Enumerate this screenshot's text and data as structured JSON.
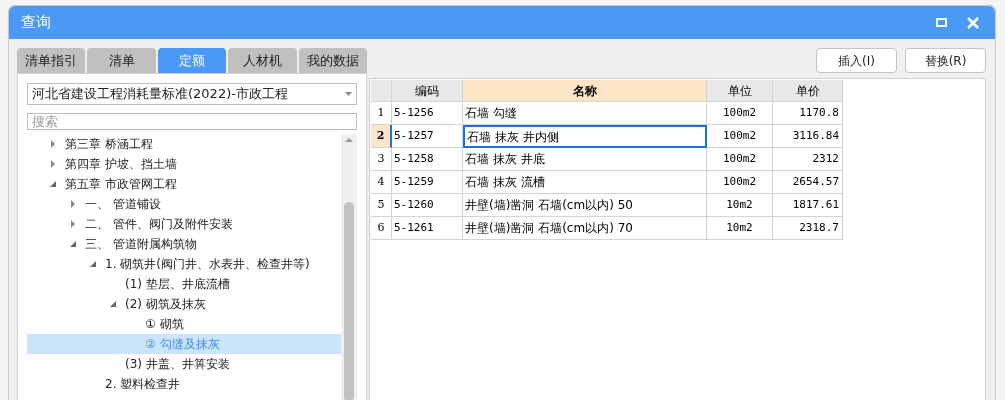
{
  "window": {
    "title": "查询"
  },
  "tabs": [
    {
      "label": "清单指引",
      "selected": false
    },
    {
      "label": "清单",
      "selected": false
    },
    {
      "label": "定额",
      "selected": true
    },
    {
      "label": "人材机",
      "selected": false
    },
    {
      "label": "我的数据",
      "selected": false
    }
  ],
  "library_select": {
    "value": "河北省建设工程消耗量标准(2022)-市政工程"
  },
  "search": {
    "placeholder": "搜索"
  },
  "tree": [
    {
      "label": "第三章 桥涵工程",
      "expanded": false,
      "selected": false
    },
    {
      "label": "第四章 护坡、挡土墙",
      "expanded": false,
      "selected": false
    },
    {
      "label": "第五章 市政管网工程",
      "expanded": true,
      "selected": false,
      "children": [
        {
          "label": "一、 管道铺设",
          "expanded": false,
          "selected": false
        },
        {
          "label": "二、 管件、阀门及附件安装",
          "expanded": false,
          "selected": false
        },
        {
          "label": "三、 管道附属构筑物",
          "expanded": true,
          "selected": false,
          "children": [
            {
              "label": "1. 砌筑井(阀门井、水表井、检查井等)",
              "expanded": true,
              "selected": false,
              "children": [
                {
                  "label": "(1) 垫层、井底流槽",
                  "selected": false
                },
                {
                  "label": "(2) 砌筑及抹灰",
                  "expanded": true,
                  "selected": false,
                  "children": [
                    {
                      "label": "① 砌筑",
                      "selected": false
                    },
                    {
                      "label": "② 勾缝及抹灰",
                      "selected": true
                    }
                  ]
                },
                {
                  "label": "(3) 井盖、井箅安装",
                  "selected": false
                }
              ]
            },
            {
              "label": "2. 塑料检查井",
              "selected": false
            }
          ]
        }
      ]
    }
  ],
  "buttons": [
    "插入(I)",
    "替换(R)"
  ],
  "table": {
    "columns": [
      {
        "label": "编码",
        "selected": false
      },
      {
        "label": "名称",
        "selected": true
      },
      {
        "label": "单位",
        "selected": false
      },
      {
        "label": "单价",
        "selected": false
      }
    ],
    "rows": [
      {
        "number": "1",
        "code": "5-1256",
        "name": "石墙 勾缝",
        "unit": "100m2",
        "price": "1170.8",
        "selected": false
      },
      {
        "number": "2",
        "code": "5-1257",
        "name": "石墙 抹灰 井内侧",
        "unit": "100m2",
        "price": "3116.84",
        "selected": true
      },
      {
        "number": "3",
        "code": "5-1258",
        "name": "石墙 抹灰 井底",
        "unit": "100m2",
        "price": "2312",
        "selected": false
      },
      {
        "number": "4",
        "code": "5-1259",
        "name": "石墙 抹灰 流槽",
        "unit": "100m2",
        "price": "2654.57",
        "selected": false
      },
      {
        "number": "5",
        "code": "5-1260",
        "name": "井壁(墙)凿洞 石墙(cm以内) 50",
        "unit": "10m2",
        "price": "1817.61",
        "selected": false
      },
      {
        "number": "6",
        "code": "5-1261",
        "name": "井壁(墙)凿洞 石墙(cm以内) 70",
        "unit": "10m2",
        "price": "2318.7",
        "selected": false
      }
    ]
  }
}
